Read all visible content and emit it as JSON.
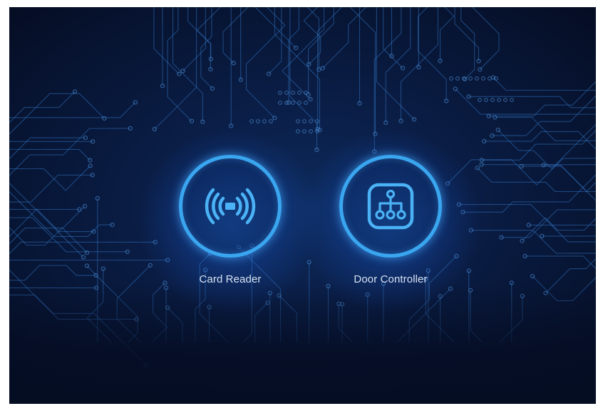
{
  "devices": [
    {
      "label": "Card Reader",
      "icon": "card-reader-icon"
    },
    {
      "label": "Door Controller",
      "icon": "door-controller-icon"
    }
  ],
  "colors": {
    "background": "#071432",
    "accent": "#3aa6f0",
    "circuit": "#2f6fb8",
    "label": "#d6e2f2"
  }
}
